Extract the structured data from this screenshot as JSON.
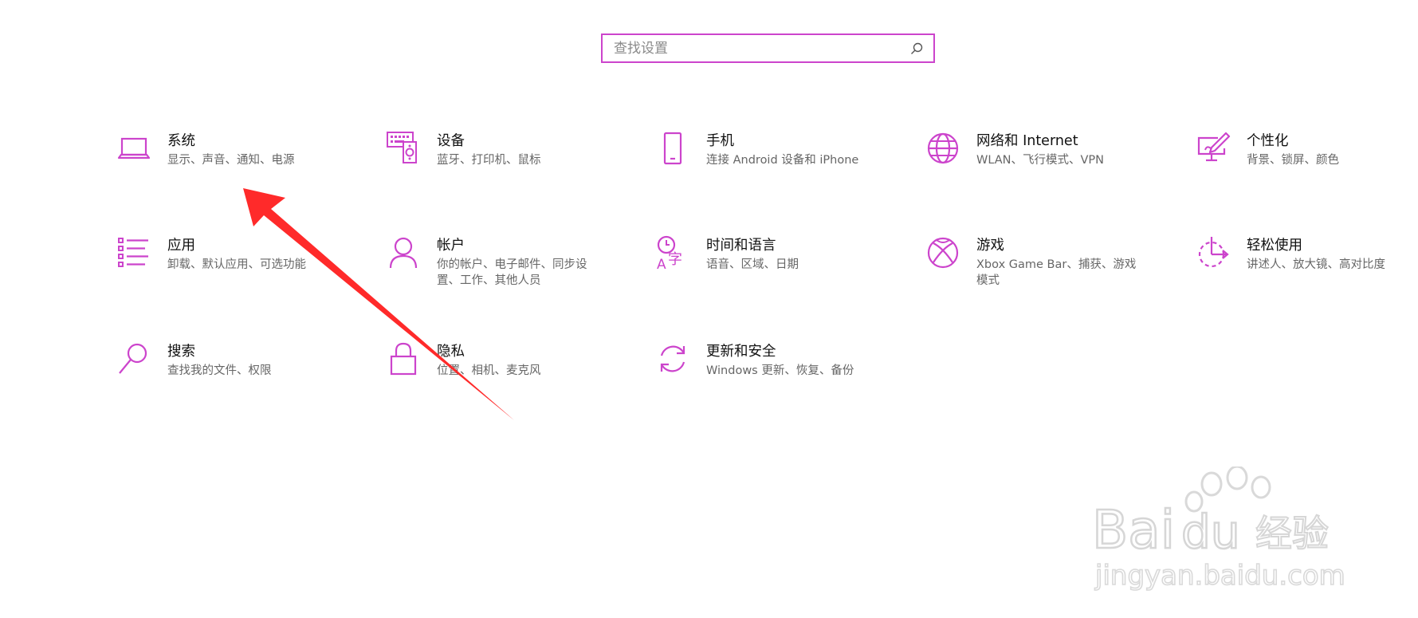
{
  "search": {
    "placeholder": "查找设置",
    "value": "",
    "accent": "#cc44cc"
  },
  "colors": {
    "accent": "#cc44cc",
    "title": "#111111",
    "desc": "#666666",
    "arrow": "#ff2a2a"
  },
  "tiles": [
    {
      "icon": "laptop-icon",
      "title": "系统",
      "desc": "显示、声音、通知、电源"
    },
    {
      "icon": "keyboard-speaker-icon",
      "title": "设备",
      "desc": "蓝牙、打印机、鼠标"
    },
    {
      "icon": "phone-icon",
      "title": "手机",
      "desc": "连接 Android 设备和 iPhone"
    },
    {
      "icon": "globe-icon",
      "title": "网络和 Internet",
      "desc": "WLAN、飞行模式、VPN"
    },
    {
      "icon": "paint-monitor-icon",
      "title": "个性化",
      "desc": "背景、锁屏、颜色"
    },
    {
      "icon": "app-list-icon",
      "title": "应用",
      "desc": "卸载、默认应用、可选功能"
    },
    {
      "icon": "person-icon",
      "title": "帐户",
      "desc": "你的帐户、电子邮件、同步设置、工作、其他人员"
    },
    {
      "icon": "clock-language-icon",
      "title": "时间和语言",
      "desc": "语音、区域、日期"
    },
    {
      "icon": "xbox-icon",
      "title": "游戏",
      "desc": "Xbox Game Bar、捕获、游戏模式"
    },
    {
      "icon": "ease-of-access-icon",
      "title": "轻松使用",
      "desc": "讲述人、放大镜、高对比度"
    },
    {
      "icon": "search-magnifier-icon",
      "title": "搜索",
      "desc": "查找我的文件、权限"
    },
    {
      "icon": "lock-icon",
      "title": "隐私",
      "desc": "位置、相机、麦克风"
    },
    {
      "icon": "sync-icon",
      "title": "更新和安全",
      "desc": "Windows 更新、恢复、备份"
    }
  ],
  "watermark": {
    "brand": "Bai du 经验",
    "url": "jingyan.baidu.com"
  }
}
